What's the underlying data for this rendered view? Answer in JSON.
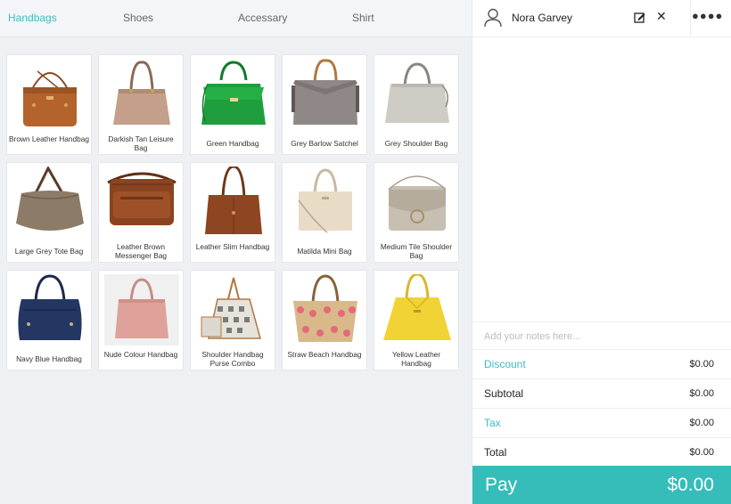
{
  "tabs": [
    {
      "label": "Handbags",
      "active": true
    },
    {
      "label": "Shoes"
    },
    {
      "label": "Accessary"
    },
    {
      "label": "Shirt"
    }
  ],
  "products": [
    {
      "name": "Brown Leather Handbag"
    },
    {
      "name": "Darkish Tan Leisure Bag"
    },
    {
      "name": "Green Handbag"
    },
    {
      "name": "Grey Barlow Satchel"
    },
    {
      "name": "Grey Shoulder Bag"
    },
    {
      "name": "Large Grey Tote Bag"
    },
    {
      "name": "Leather Brown Messenger Bag"
    },
    {
      "name": "Leather Slim Handbag"
    },
    {
      "name": "Matilda Mini Bag"
    },
    {
      "name": "Medium Tile Shoulder Bag"
    },
    {
      "name": "Navy Blue Handbag"
    },
    {
      "name": "Nude Colour Handbag"
    },
    {
      "name": "Shoulder Handbag Purse Combo"
    },
    {
      "name": "Straw Beach Handbag"
    },
    {
      "name": "Yellow Leather Handbag"
    }
  ],
  "customer": {
    "name": "Nora Garvey",
    "icon": "user-icon"
  },
  "notes": {
    "placeholder": "Add your notes here..."
  },
  "summary": {
    "discount_label": "Discount",
    "discount_value": "$0.00",
    "subtotal_label": "Subtotal",
    "subtotal_value": "$0.00",
    "tax_label": "Tax",
    "tax_value": "$0.00",
    "total_label": "Total",
    "total_value": "$0.00"
  },
  "pay": {
    "label": "Pay",
    "amount": "$0.00"
  },
  "colors": {
    "accent": "#3dbcc0",
    "pay_bg": "#36bdb9",
    "panel_bg": "#eef0f4"
  }
}
